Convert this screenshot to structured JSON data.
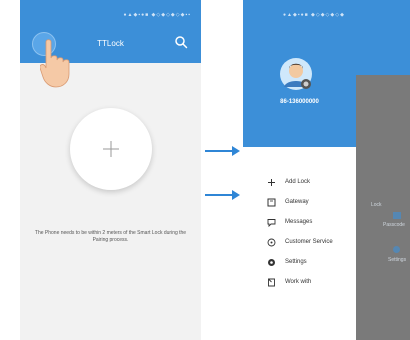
{
  "screen_left": {
    "status_bar": "●▲◆▪●■  ◆◇◆◇◆◇◆▪▪",
    "title": "TTLock",
    "hint": "The Phone needs to be within 2 meters of the Smart Lock during the Pairing process."
  },
  "screen_right": {
    "status_bar": "●▲◆▪●■  ◆◇◆◇◆◇◆",
    "username": "86-136000000",
    "menu": [
      {
        "label": "Add Lock",
        "icon": "plus-icon"
      },
      {
        "label": "Gateway",
        "icon": "gateway-icon"
      },
      {
        "label": "Messages",
        "icon": "message-icon"
      },
      {
        "label": "Customer Service",
        "icon": "customer-service-icon"
      },
      {
        "label": "Settings",
        "icon": "settings-icon"
      },
      {
        "label": "Work with",
        "icon": "work-with-icon"
      }
    ],
    "background": {
      "strip_title": "Lock",
      "strip_label": "Passcode",
      "strip_label2": "Settings"
    }
  },
  "colors": {
    "primary": "#3c8fd8",
    "overlay": "#7a7a7a",
    "arrow": "#2f86d6"
  }
}
